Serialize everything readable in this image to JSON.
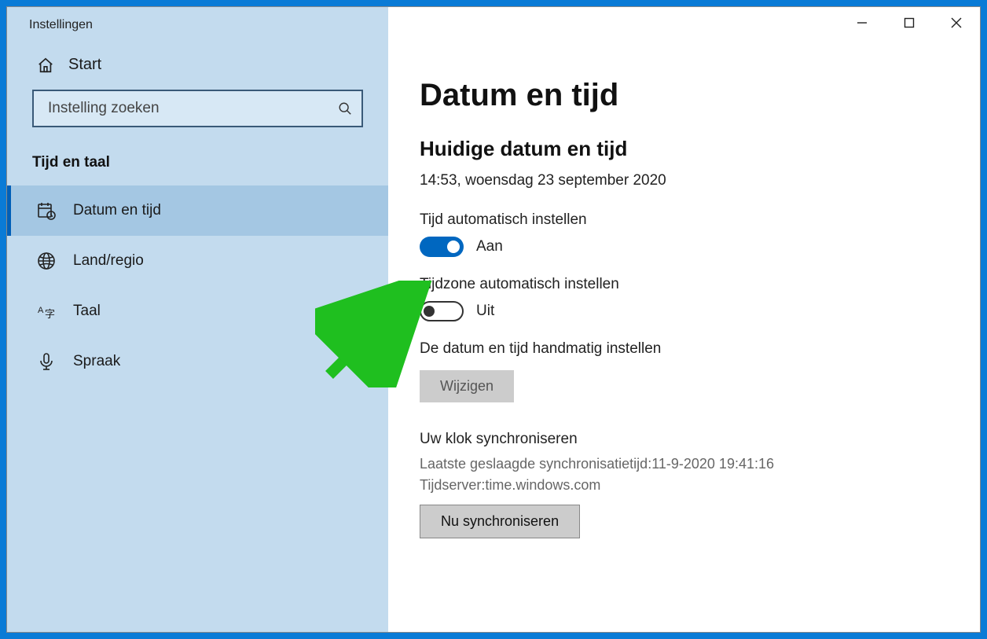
{
  "app": {
    "title": "Instellingen"
  },
  "sidebar": {
    "home_label": "Start",
    "search_placeholder": "Instelling zoeken",
    "section_title": "Tijd en taal",
    "items": [
      {
        "label": "Datum en tijd"
      },
      {
        "label": "Land/regio"
      },
      {
        "label": "Taal"
      },
      {
        "label": "Spraak"
      }
    ]
  },
  "main": {
    "page_title": "Datum en tijd",
    "current": {
      "heading": "Huidige datum en tijd",
      "value": "14:53, woensdag 23 september 2020"
    },
    "auto_time": {
      "label": "Tijd automatisch instellen",
      "state_label": "Aan",
      "on": true
    },
    "auto_tz": {
      "label": "Tijdzone automatisch instellen",
      "state_label": "Uit",
      "on": false
    },
    "manual": {
      "label": "De datum en tijd handmatig instellen",
      "button": "Wijzigen"
    },
    "sync": {
      "heading": "Uw klok synchroniseren",
      "last_label": "Laatste geslaagde synchronisatietijd:",
      "last_value": "11-9-2020 19:41:16",
      "server_label": "Tijdserver:",
      "server_value": "time.windows.com",
      "button": "Nu synchroniseren"
    }
  }
}
